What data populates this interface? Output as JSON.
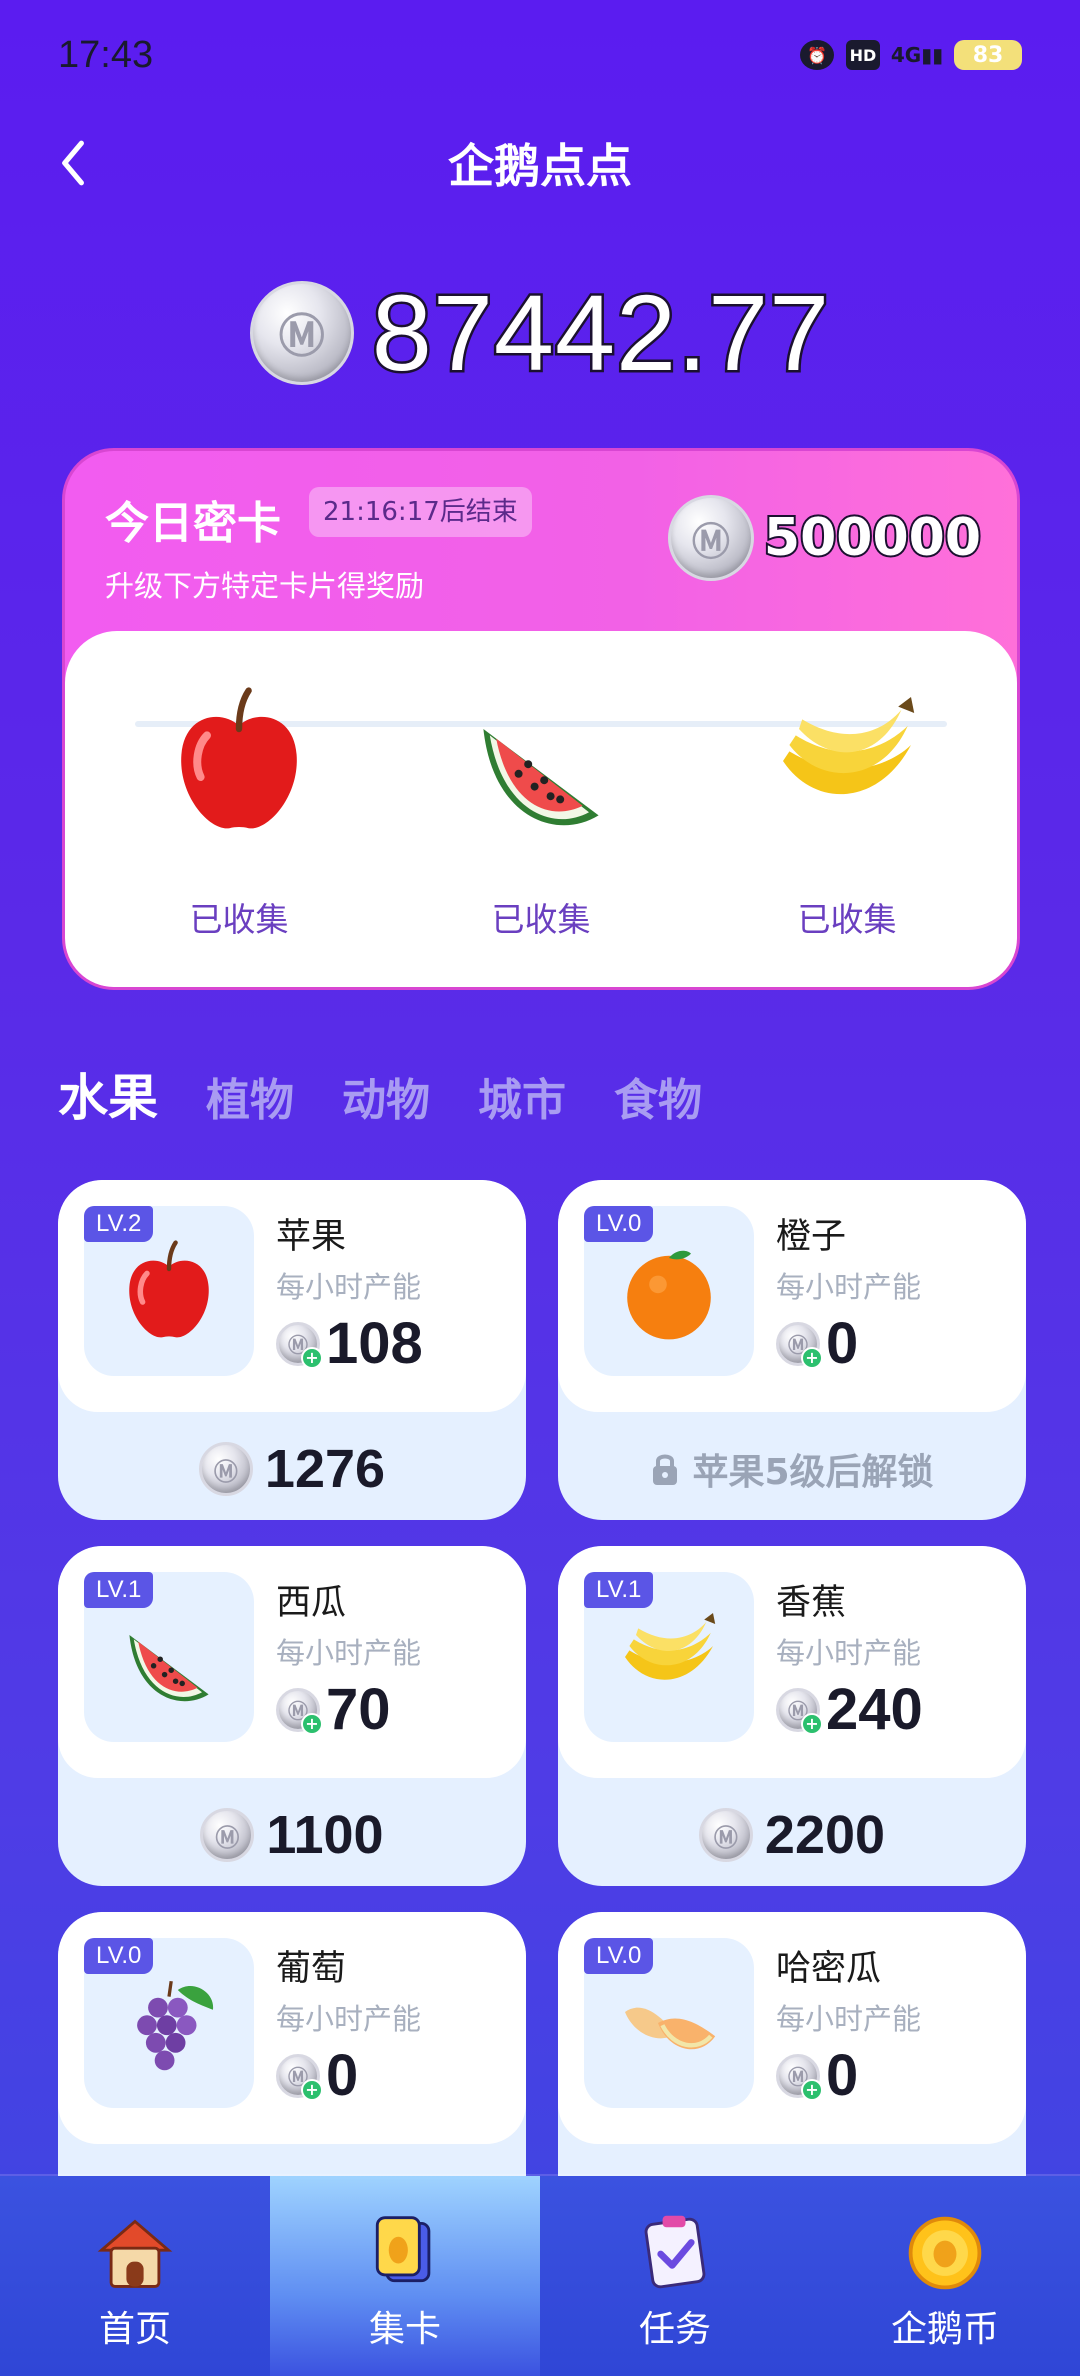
{
  "status_bar": {
    "time": "17:43",
    "network": "4G",
    "battery": "83"
  },
  "header": {
    "title": "企鹅点点"
  },
  "balance": {
    "value": "87442.77",
    "coin_icon": "coin-icon"
  },
  "secret_card": {
    "title": "今日密卡",
    "timer": "21:16:17后结束",
    "subtitle": "升级下方特定卡片得奖励",
    "reward": "500000",
    "items": [
      {
        "fruit": "apple",
        "status": "已收集"
      },
      {
        "fruit": "watermelon",
        "status": "已收集"
      },
      {
        "fruit": "banana",
        "status": "已收集"
      }
    ]
  },
  "categories": {
    "tabs": [
      "水果",
      "植物",
      "动物",
      "城市",
      "食物"
    ],
    "active": "水果"
  },
  "cards": [
    {
      "level": "LV.2",
      "name": "苹果",
      "rate_label": "每小时产能",
      "rate": "108",
      "cost": "1276",
      "icon": "apple-icon"
    },
    {
      "level": "LV.0",
      "name": "橙子",
      "rate_label": "每小时产能",
      "rate": "0",
      "locked_text": "苹果5级后解锁",
      "icon": "orange-icon"
    },
    {
      "level": "LV.1",
      "name": "西瓜",
      "rate_label": "每小时产能",
      "rate": "70",
      "cost": "1100",
      "icon": "watermelon-icon"
    },
    {
      "level": "LV.1",
      "name": "香蕉",
      "rate_label": "每小时产能",
      "rate": "240",
      "cost": "2200",
      "icon": "banana-icon"
    },
    {
      "level": "LV.0",
      "name": "葡萄",
      "rate_label": "每小时产能",
      "rate": "0",
      "icon": "grape-icon"
    },
    {
      "level": "LV.0",
      "name": "哈密瓜",
      "rate_label": "每小时产能",
      "rate": "0",
      "icon": "cantaloupe-icon"
    }
  ],
  "bottom_nav": [
    {
      "label": "首页",
      "icon": "home-icon"
    },
    {
      "label": "集卡",
      "icon": "card-collection-icon",
      "active": true
    },
    {
      "label": "任务",
      "icon": "task-icon"
    },
    {
      "label": "企鹅币",
      "icon": "penguin-coin-icon"
    }
  ],
  "colors": {
    "background": "#5b1cf0",
    "secret_card": "#f25cf0",
    "level_badge": "#5b55e6",
    "nav": "#3b52e0"
  }
}
